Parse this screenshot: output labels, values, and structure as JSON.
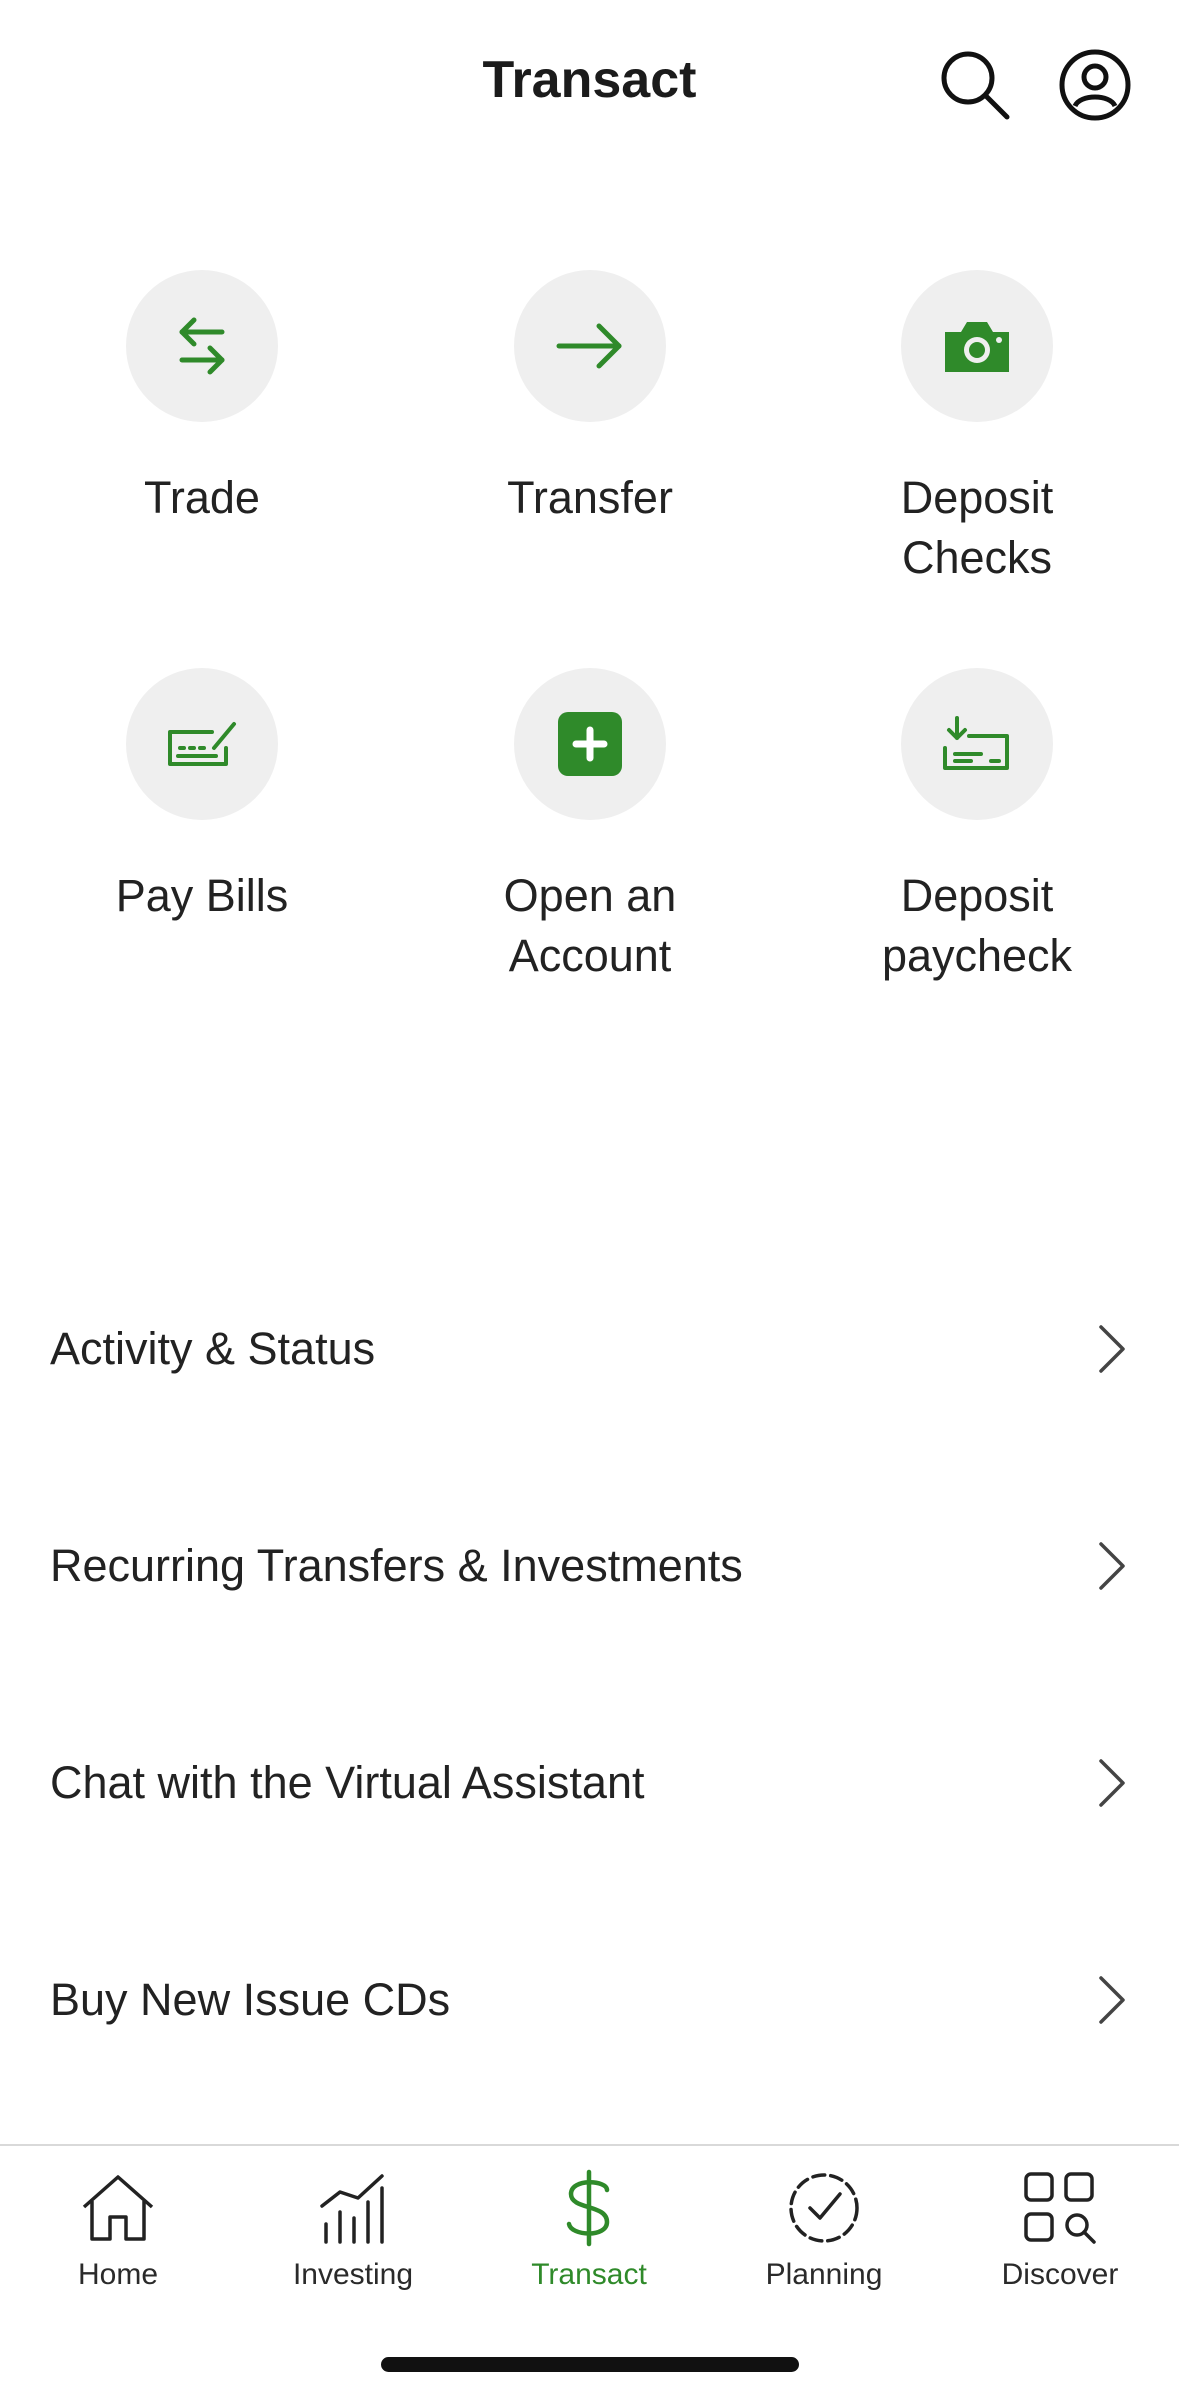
{
  "header": {
    "title": "Transact"
  },
  "colors": {
    "accent": "#2f8a2a",
    "circle_bg": "#efefef",
    "text": "#222222"
  },
  "actions": [
    {
      "label": "Trade",
      "icon": "swap-arrows-icon"
    },
    {
      "label": "Transfer",
      "icon": "arrow-right-icon"
    },
    {
      "label": "Deposit\nChecks",
      "icon": "camera-icon"
    },
    {
      "label": "Pay Bills",
      "icon": "check-signature-icon"
    },
    {
      "label": "Open an\nAccount",
      "icon": "plus-square-icon"
    },
    {
      "label": "Deposit\npaycheck",
      "icon": "paycheck-download-icon"
    }
  ],
  "menu": [
    {
      "label": "Activity & Status"
    },
    {
      "label": "Recurring Transfers & Investments"
    },
    {
      "label": "Chat with the Virtual Assistant"
    },
    {
      "label": "Buy New Issue CDs"
    }
  ],
  "tabs": [
    {
      "label": "Home",
      "icon": "house-icon",
      "active": false
    },
    {
      "label": "Investing",
      "icon": "chart-bars-icon",
      "active": false
    },
    {
      "label": "Transact",
      "icon": "dollar-icon",
      "active": true
    },
    {
      "label": "Planning",
      "icon": "check-circle-icon",
      "active": false
    },
    {
      "label": "Discover",
      "icon": "grid-search-icon",
      "active": false
    }
  ]
}
